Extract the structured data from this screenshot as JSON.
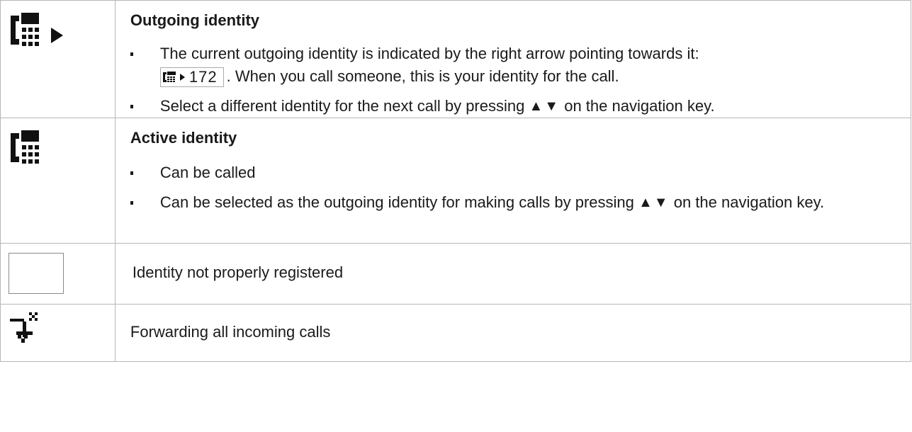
{
  "rows": [
    {
      "icon": "outgoing-identity-phone-icon",
      "heading": "Outgoing identity",
      "bullets": {
        "first_part1": "The current outgoing identity is indicated by the right arrow pointing towards it:",
        "display_number": "172",
        "first_part2": ". When you call someone, this is your identity for the call.",
        "second_part1": "Select a different identity for the next call by pressing",
        "arrows": "▲▼",
        "second_part2": "on the navigation key."
      }
    },
    {
      "icon": "active-identity-phone-icon",
      "heading": "Active identity",
      "bullets": {
        "first": "Can be called",
        "second_part1": "Can be selected as the outgoing identity for making calls by pressing",
        "arrows": "▲▼",
        "second_part2": "on the navigation key."
      }
    },
    {
      "icon": "empty-box-icon",
      "text": "Identity not properly registered"
    },
    {
      "icon": "call-forward-icon",
      "text": "Forwarding all incoming calls"
    }
  ]
}
